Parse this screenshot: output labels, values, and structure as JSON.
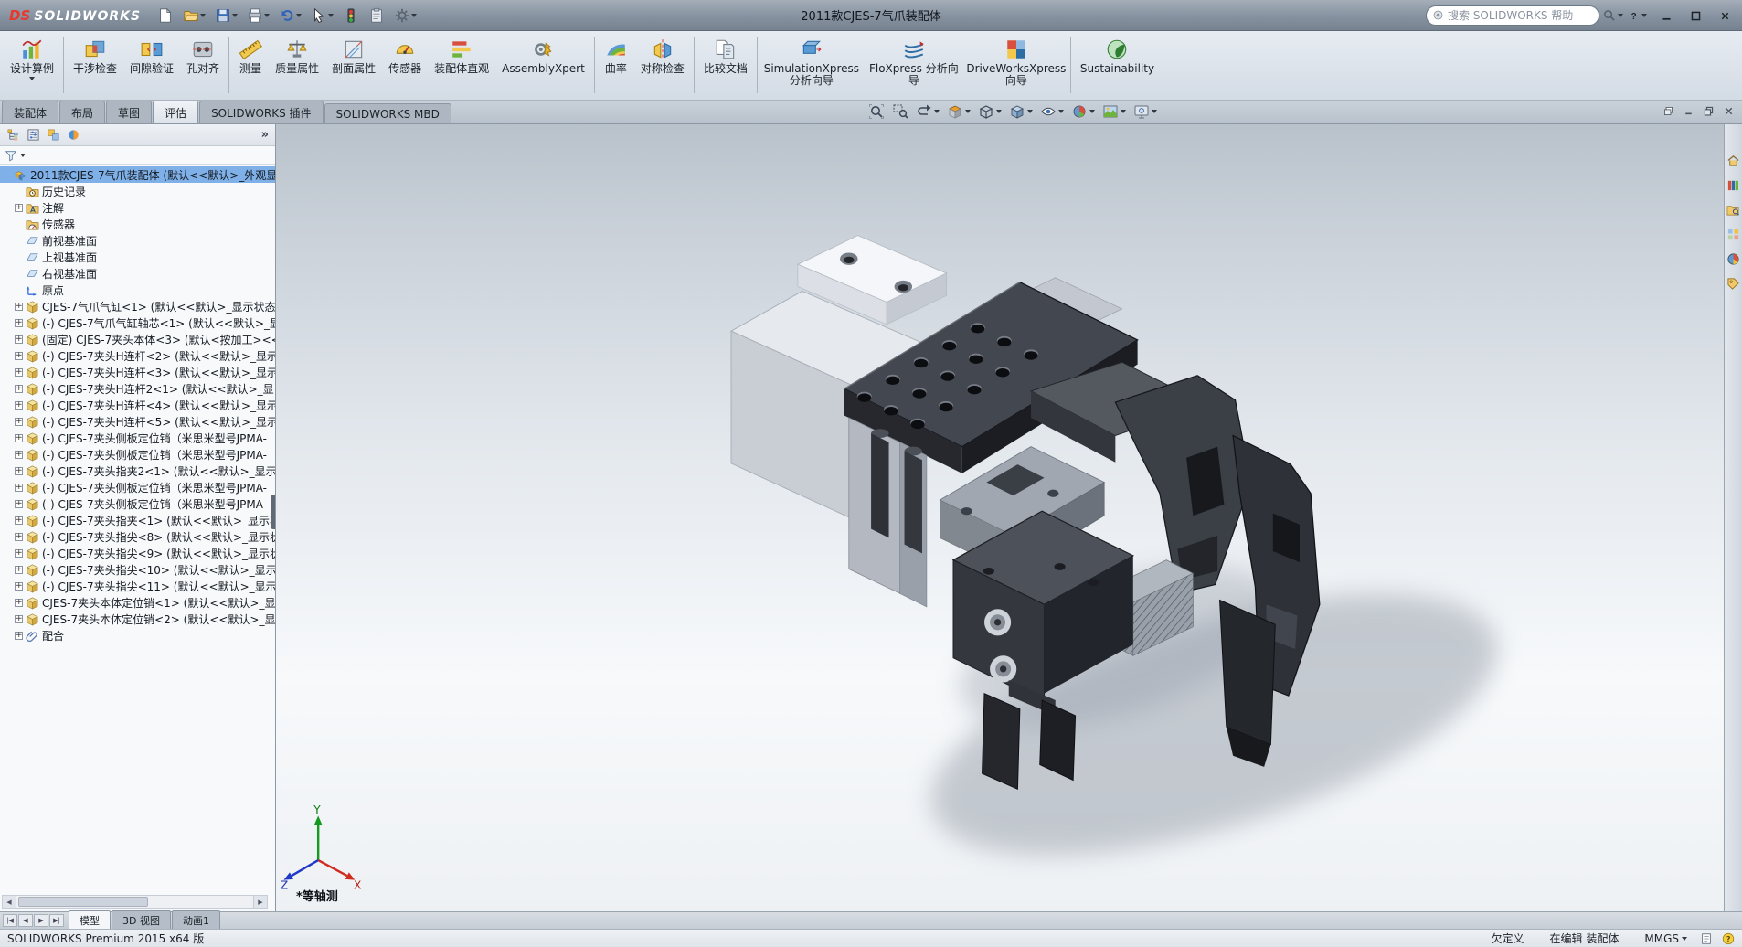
{
  "title_bar": {
    "logo_prefix": "DS",
    "logo_text": "SOLIDWORKS",
    "document_title": "2011款CJES-7气爪装配体",
    "search_placeholder": "搜索 SOLIDWORKS 帮助",
    "quick_tools": [
      {
        "icon": "new-doc",
        "caret": false
      },
      {
        "icon": "open-folder",
        "caret": true
      },
      {
        "icon": "save",
        "caret": true
      },
      {
        "icon": "print",
        "caret": true
      },
      {
        "icon": "undo",
        "caret": true
      },
      {
        "icon": "select-arrow",
        "caret": true
      },
      {
        "icon": "rebuild",
        "caret": false
      },
      {
        "icon": "file-properties",
        "caret": false
      },
      {
        "icon": "options-gear",
        "caret": true
      }
    ],
    "window_buttons": [
      {
        "icon": "help",
        "caret": true
      },
      {
        "icon": "minimize",
        "caret": false
      },
      {
        "icon": "maximize",
        "caret": false
      },
      {
        "icon": "close",
        "caret": false
      }
    ]
  },
  "ribbon": {
    "buttons": [
      {
        "icon": "design-study",
        "label": "设计算例",
        "caret": true,
        "group_end": true
      },
      {
        "icon": "interference-check",
        "label": "干涉检查",
        "caret": false,
        "group_end": false
      },
      {
        "icon": "clearance-verify",
        "label": "间隙验证",
        "caret": false,
        "group_end": false
      },
      {
        "icon": "hole-alignment",
        "label": "孔对齐",
        "caret": false,
        "group_end": true
      },
      {
        "icon": "measure",
        "label": "测量",
        "caret": false,
        "group_end": false
      },
      {
        "icon": "mass-properties",
        "label": "质量属性",
        "caret": false,
        "group_end": false
      },
      {
        "icon": "section-properties",
        "label": "剖面属性",
        "caret": false,
        "group_end": false
      },
      {
        "icon": "sensor",
        "label": "传感器",
        "caret": false,
        "group_end": false
      },
      {
        "icon": "assembly-visualization",
        "label": "装配体直观",
        "caret": false,
        "group_end": false
      },
      {
        "icon": "assemblyxpert",
        "label": "AssemblyXpert",
        "caret": false,
        "group_end": true
      },
      {
        "icon": "curvature",
        "label": "曲率",
        "caret": false,
        "group_end": false
      },
      {
        "icon": "symmetry-check",
        "label": "对称检查",
        "caret": false,
        "group_end": true
      },
      {
        "icon": "compare-documents",
        "label": "比较文档",
        "caret": false,
        "group_end": true
      },
      {
        "icon": "simulationxpress",
        "label": "SimulationXpress 分析向导",
        "caret": false,
        "group_end": false
      },
      {
        "icon": "floxpress",
        "label": "FloXpress 分析向导",
        "caret": false,
        "group_end": false
      },
      {
        "icon": "driveworksxpress",
        "label": "DriveWorksXpress 向导",
        "caret": false,
        "group_end": true
      },
      {
        "icon": "sustainability",
        "label": "Sustainability",
        "caret": false,
        "group_end": false
      }
    ],
    "tabs": [
      {
        "label": "装配体",
        "active": false
      },
      {
        "label": "布局",
        "active": false
      },
      {
        "label": "草图",
        "active": false
      },
      {
        "label": "评估",
        "active": true
      },
      {
        "label": "SOLIDWORKS 插件",
        "active": false
      },
      {
        "label": "SOLIDWORKS MBD",
        "active": false
      }
    ]
  },
  "document_window": {
    "buttons": [
      {
        "icon": "doc-cascade"
      },
      {
        "icon": "doc-minimize"
      },
      {
        "icon": "doc-restore"
      },
      {
        "icon": "doc-close"
      }
    ]
  },
  "feature_tree": {
    "header_icons": [
      "fm-tree",
      "fm-properties",
      "fm-configurations",
      "fm-display"
    ],
    "collapse_glyph": "»",
    "items": [
      {
        "icon": "assembly",
        "label": "2011款CJES-7气爪装配体 (默认<<默认>_外观显",
        "root": true,
        "selected": true,
        "expand": false
      },
      {
        "icon": "history",
        "label": "历史记录",
        "expand": false
      },
      {
        "icon": "annotations",
        "label": "注解",
        "expand": true
      },
      {
        "icon": "sensors",
        "label": "传感器",
        "expand": false
      },
      {
        "icon": "plane",
        "label": "前视基准面",
        "expand": false
      },
      {
        "icon": "plane",
        "label": "上视基准面",
        "expand": false
      },
      {
        "icon": "plane",
        "label": "右视基准面",
        "expand": false
      },
      {
        "icon": "origin",
        "label": "原点",
        "expand": false
      },
      {
        "icon": "part",
        "label": "CJES-7气爪气缸<1> (默认<<默认>_显示状态",
        "expand": true
      },
      {
        "icon": "part",
        "label": "(-) CJES-7气爪气缸轴芯<1> (默认<<默认>_显",
        "expand": true
      },
      {
        "icon": "part",
        "label": "(固定) CJES-7夹头本体<3> (默认<按加工><<",
        "expand": true
      },
      {
        "icon": "part",
        "label": "(-) CJES-7夹头H连杆<2> (默认<<默认>_显示",
        "expand": true
      },
      {
        "icon": "part",
        "label": "(-) CJES-7夹头H连杆<3> (默认<<默认>_显示",
        "expand": true
      },
      {
        "icon": "part",
        "label": "(-) CJES-7夹头H连杆2<1> (默认<<默认>_显",
        "expand": true
      },
      {
        "icon": "part",
        "label": "(-) CJES-7夹头H连杆<4> (默认<<默认>_显示",
        "expand": true
      },
      {
        "icon": "part",
        "label": "(-) CJES-7夹头H连杆<5> (默认<<默认>_显示",
        "expand": true
      },
      {
        "icon": "part",
        "label": "(-) CJES-7夹头侧板定位销（米思米型号JPMA-",
        "expand": true
      },
      {
        "icon": "part",
        "label": "(-) CJES-7夹头侧板定位销（米思米型号JPMA-",
        "expand": true
      },
      {
        "icon": "part",
        "label": "(-) CJES-7夹头指夹2<1> (默认<<默认>_显示",
        "expand": true
      },
      {
        "icon": "part",
        "label": "(-) CJES-7夹头侧板定位销（米思米型号JPMA-",
        "expand": true
      },
      {
        "icon": "part",
        "label": "(-) CJES-7夹头侧板定位销（米思米型号JPMA-",
        "expand": true
      },
      {
        "icon": "part",
        "label": "(-) CJES-7夹头指夹<1> (默认<<默认>_显示状",
        "expand": true
      },
      {
        "icon": "part",
        "label": "(-) CJES-7夹头指尖<8> (默认<<默认>_显示状",
        "expand": true
      },
      {
        "icon": "part",
        "label": "(-) CJES-7夹头指尖<9> (默认<<默认>_显示状",
        "expand": true
      },
      {
        "icon": "part",
        "label": "(-) CJES-7夹头指尖<10> (默认<<默认>_显示",
        "expand": true
      },
      {
        "icon": "part",
        "label": "(-) CJES-7夹头指尖<11> (默认<<默认>_显示",
        "expand": true
      },
      {
        "icon": "part",
        "label": "CJES-7夹头本体定位销<1> (默认<<默认>_显",
        "expand": true
      },
      {
        "icon": "part",
        "label": "CJES-7夹头本体定位销<2> (默认<<默认>_显",
        "expand": true
      },
      {
        "icon": "mates",
        "label": "配合",
        "expand": true
      }
    ]
  },
  "viewport": {
    "view_label": "*等轴测",
    "axis_labels": {
      "x": "X",
      "y": "Y",
      "z": "Z"
    },
    "heads_up_tools": [
      {
        "icon": "zoom-fit",
        "caret": false
      },
      {
        "icon": "zoom-area",
        "caret": false
      },
      {
        "icon": "previous-view",
        "caret": true
      },
      {
        "icon": "section-view",
        "caret": true
      },
      {
        "icon": "view-orientation",
        "caret": true
      },
      {
        "icon": "display-style",
        "caret": true
      },
      {
        "icon": "hide-show",
        "caret": true
      },
      {
        "icon": "edit-appearance",
        "caret": true
      },
      {
        "icon": "apply-scene",
        "caret": true
      },
      {
        "icon": "view-settings",
        "caret": true
      }
    ]
  },
  "task_pane": {
    "tabs": [
      "sw-resources",
      "design-library",
      "file-explorer",
      "view-palette",
      "appearances",
      "custom-properties"
    ]
  },
  "bottom_bar": {
    "nav": [
      "|◀",
      "◀",
      "▶",
      "▶|"
    ],
    "tabs": [
      {
        "label": "模型",
        "active": true
      },
      {
        "label": "3D 视图",
        "active": false
      },
      {
        "label": "动画1",
        "active": false
      }
    ]
  },
  "status_bar": {
    "left_text": "SOLIDWORKS Premium 2015 x64 版",
    "items": [
      {
        "label": "欠定义",
        "caret": false
      },
      {
        "label": "在编辑 装配体",
        "caret": false
      },
      {
        "label": "MMGS",
        "caret": true
      }
    ]
  }
}
